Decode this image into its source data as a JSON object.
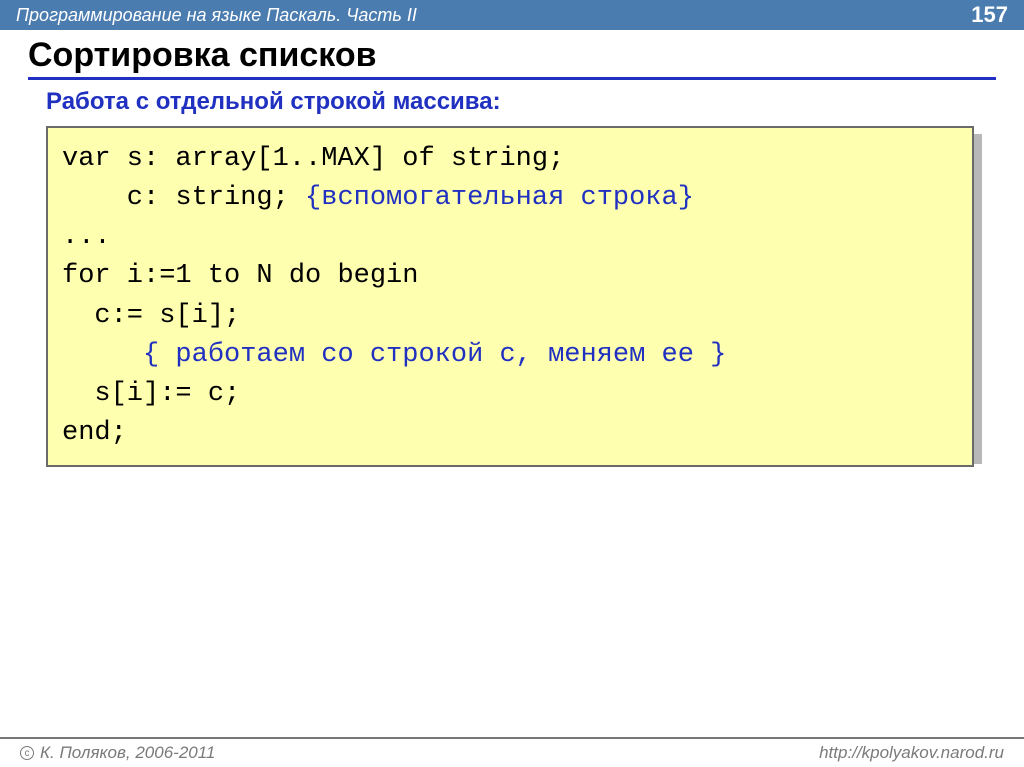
{
  "header": {
    "course_title": "Программирование на языке Паскаль. Часть II",
    "page_number": "157"
  },
  "slide": {
    "title": "Сортировка списков",
    "subhead": "Работа с отдельной строкой массива:"
  },
  "code": {
    "l1": "var s: array[1..MAX] of string;",
    "l2a": "    c: string; ",
    "l2b": "{вспомогательная строка}",
    "l3": "...",
    "l4": "for i:=1 to N do begin",
    "l5": "  c:= s[i];",
    "l6": "     { работаем со строкой c, меняем ее }",
    "l7": "  s[i]:= c;",
    "l8": "end;"
  },
  "footer": {
    "copyright": "К. Поляков, 2006-2011",
    "url": "http://kpolyakov.narod.ru"
  }
}
